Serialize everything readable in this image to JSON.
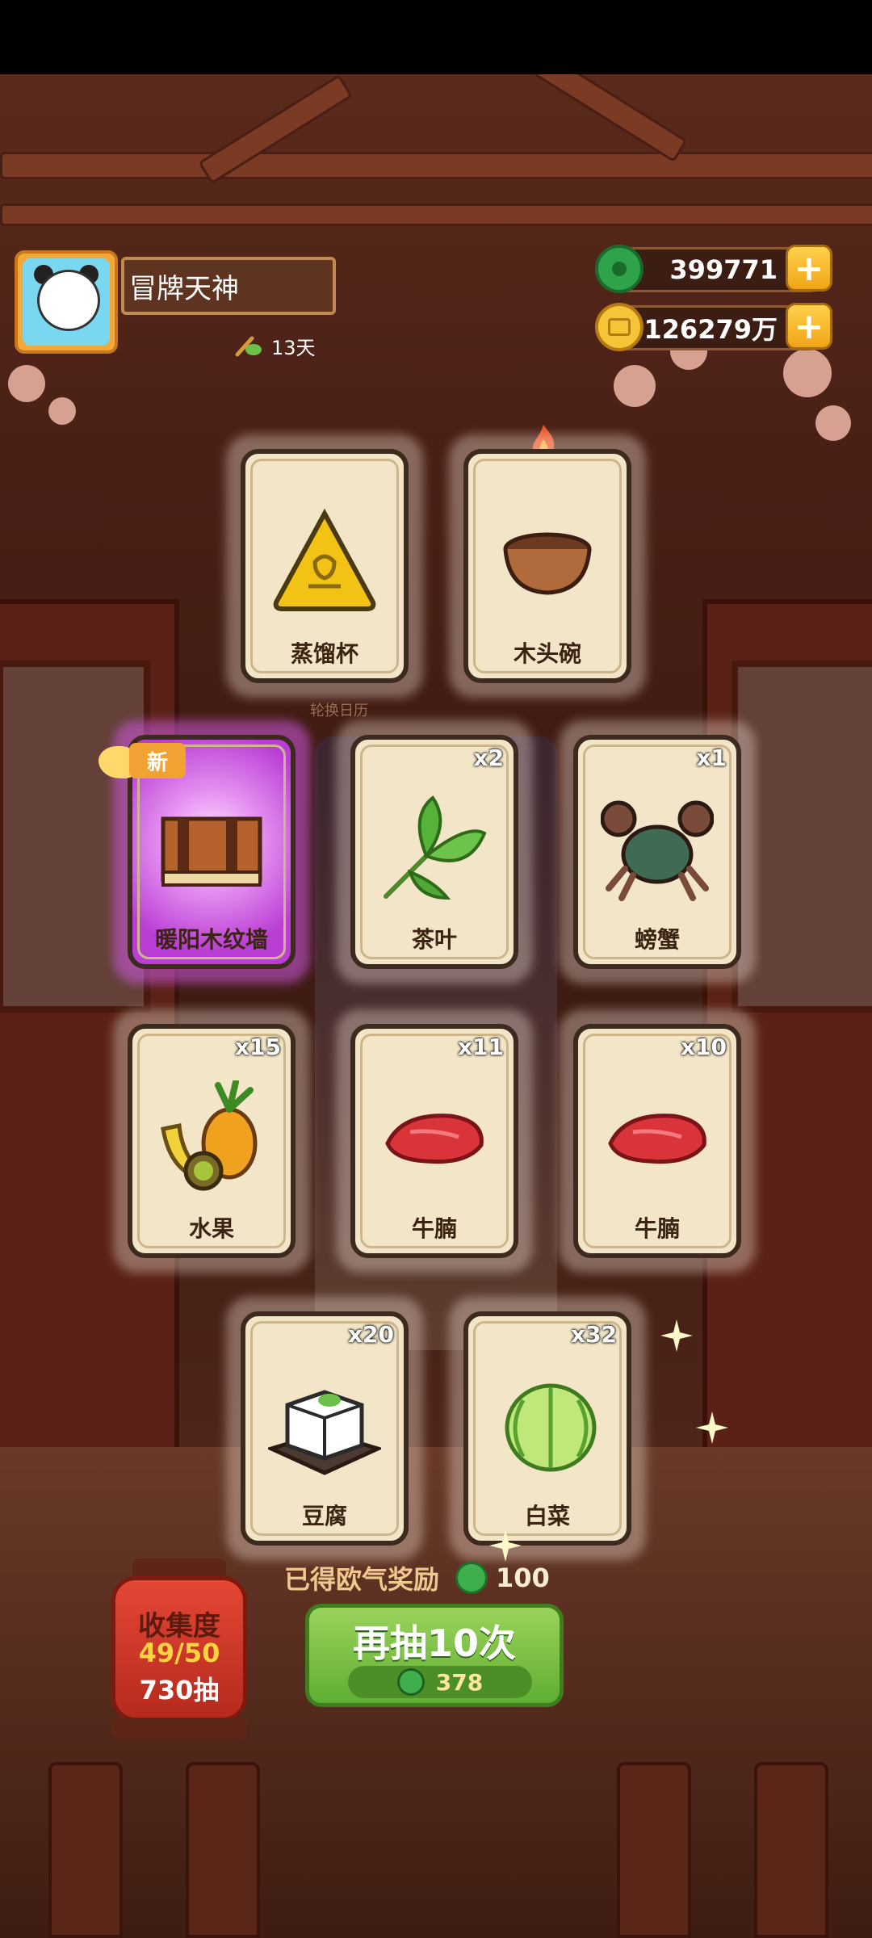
{
  "player": {
    "name": "冒牌天神",
    "days": "13天"
  },
  "currency": {
    "jade": {
      "value": "399771",
      "icon": "jade-coin-icon"
    },
    "gold": {
      "value": "126279万",
      "icon": "gold-coin-icon"
    }
  },
  "watermark": "轮换日历",
  "cards": [
    {
      "label": "蒸馏杯",
      "count": "",
      "icon": "distill-cup-icon",
      "rarity": "normal"
    },
    {
      "label": "木头碗",
      "count": "",
      "icon": "wooden-bowl-icon",
      "rarity": "normal"
    },
    {
      "label": "暖阳木纹墙",
      "count": "",
      "icon": "wood-wall-icon",
      "rarity": "purple",
      "badge": "新"
    },
    {
      "label": "茶叶",
      "count": "x2",
      "icon": "tea-leaf-icon",
      "rarity": "normal"
    },
    {
      "label": "螃蟹",
      "count": "x1",
      "icon": "crab-icon",
      "rarity": "normal"
    },
    {
      "label": "水果",
      "count": "x15",
      "icon": "fruit-icon",
      "rarity": "normal"
    },
    {
      "label": "牛腩",
      "count": "x11",
      "icon": "beef-icon",
      "rarity": "normal"
    },
    {
      "label": "牛腩",
      "count": "x10",
      "icon": "beef-icon",
      "rarity": "normal"
    },
    {
      "label": "豆腐",
      "count": "x20",
      "icon": "tofu-icon",
      "rarity": "normal"
    },
    {
      "label": "白菜",
      "count": "x32",
      "icon": "cabbage-icon",
      "rarity": "normal"
    }
  ],
  "reward": {
    "label": "已得欧气奖励",
    "value": "100"
  },
  "draw_button": {
    "label": "再抽10次",
    "cost": "378"
  },
  "collection": {
    "title": "收集度",
    "progress": "49/50",
    "draws": "730抽"
  },
  "colors": {
    "accent_green": "#6bbb3a",
    "gold": "#f1a417",
    "purple_glow": "#c84ddc"
  }
}
